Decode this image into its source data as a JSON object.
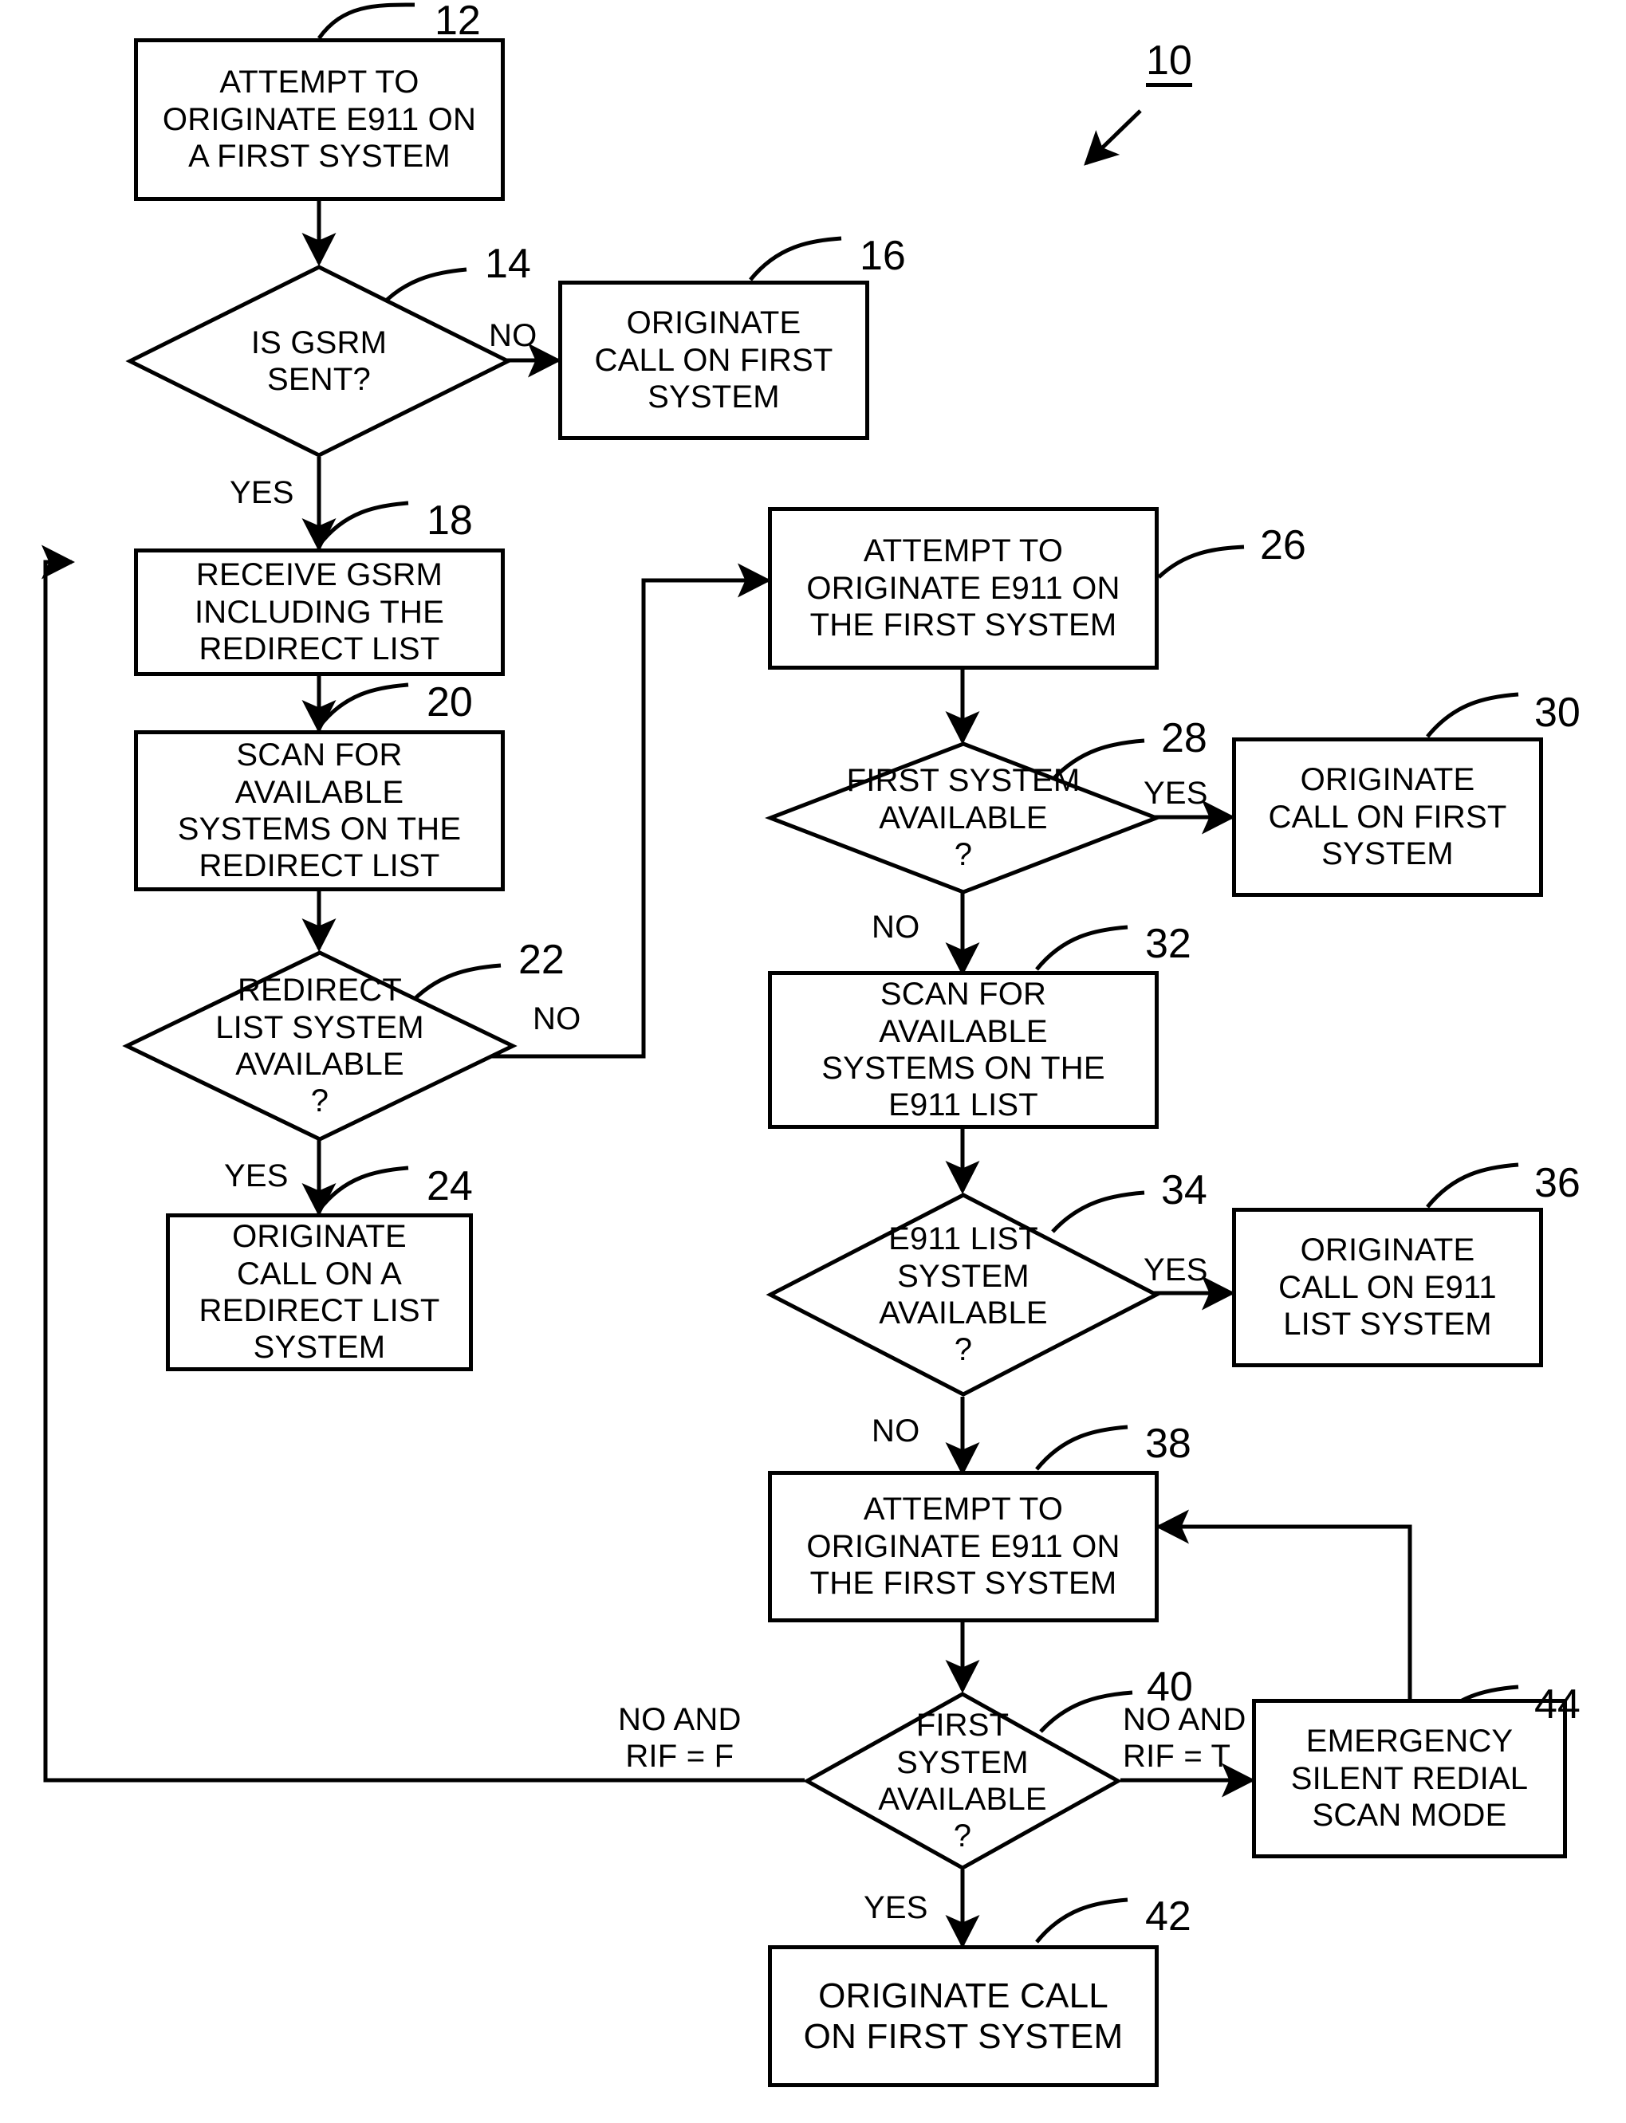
{
  "figure": {
    "reference_label": "10",
    "type": "flowchart"
  },
  "nodes": [
    {
      "id": "12",
      "ref": "12",
      "shape": "process",
      "text": "ATTEMPT TO\nORIGINATE E911 ON\nA FIRST SYSTEM"
    },
    {
      "id": "14",
      "ref": "14",
      "shape": "decision",
      "text": "IS GSRM\nSENT?"
    },
    {
      "id": "16",
      "ref": "16",
      "shape": "process",
      "text": "ORIGINATE\nCALL ON FIRST\nSYSTEM"
    },
    {
      "id": "18",
      "ref": "18",
      "shape": "process",
      "text": "RECEIVE GSRM\nINCLUDING THE\nREDIRECT LIST"
    },
    {
      "id": "20",
      "ref": "20",
      "shape": "process",
      "text": "SCAN FOR\nAVAILABLE\nSYSTEMS ON THE\nREDIRECT LIST"
    },
    {
      "id": "22",
      "ref": "22",
      "shape": "decision",
      "text": "REDIRECT\nLIST SYSTEM\nAVAILABLE\n?"
    },
    {
      "id": "24",
      "ref": "24",
      "shape": "process",
      "text": "ORIGINATE\nCALL ON A\nREDIRECT LIST\nSYSTEM"
    },
    {
      "id": "26",
      "ref": "26",
      "shape": "process",
      "text": "ATTEMPT TO\nORIGINATE E911 ON\nTHE FIRST SYSTEM"
    },
    {
      "id": "28",
      "ref": "28",
      "shape": "decision",
      "text": "FIRST SYSTEM\nAVAILABLE\n?"
    },
    {
      "id": "30",
      "ref": "30",
      "shape": "process",
      "text": "ORIGINATE\nCALL ON FIRST\nSYSTEM"
    },
    {
      "id": "32",
      "ref": "32",
      "shape": "process",
      "text": "SCAN FOR\nAVAILABLE\nSYSTEMS ON THE\nE911 LIST"
    },
    {
      "id": "34",
      "ref": "34",
      "shape": "decision",
      "text": "E911 LIST\nSYSTEM\nAVAILABLE\n?"
    },
    {
      "id": "36",
      "ref": "36",
      "shape": "process",
      "text": "ORIGINATE\nCALL ON E911\nLIST SYSTEM"
    },
    {
      "id": "38",
      "ref": "38",
      "shape": "process",
      "text": "ATTEMPT TO\nORIGINATE E911 ON\nTHE FIRST SYSTEM"
    },
    {
      "id": "40",
      "ref": "40",
      "shape": "decision",
      "text": "FIRST\nSYSTEM\nAVAILABLE\n?"
    },
    {
      "id": "42",
      "ref": "42",
      "shape": "process",
      "text": "ORIGINATE CALL\nON FIRST SYSTEM"
    },
    {
      "id": "44",
      "ref": "44",
      "shape": "process",
      "text": "EMERGENCY\nSILENT REDIAL\nSCAN MODE"
    }
  ],
  "edge_labels": {
    "e14_no": "NO",
    "e14_yes": "YES",
    "e22_no": "NO",
    "e22_yes": "YES",
    "e28_yes": "YES",
    "e28_no": "NO",
    "e34_yes": "YES",
    "e34_no": "NO",
    "e40_no_rif_f": "NO AND\nRIF = F",
    "e40_no_rif_t": "NO AND\nRIF = T",
    "e40_yes": "YES"
  },
  "colors": {
    "ink": "#000000",
    "paper": "#ffffff"
  }
}
